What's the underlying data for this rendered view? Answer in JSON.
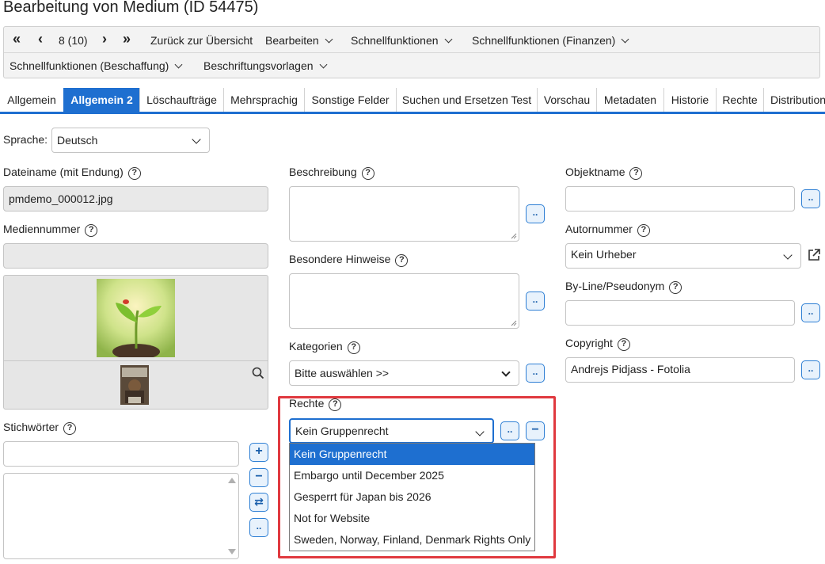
{
  "page_title": "Bearbeitung von Medium (ID 54475)",
  "toolbar": {
    "first_icon": "«",
    "prev_icon": "‹",
    "page_counter": "8 (10)",
    "next_icon": "›",
    "last_icon": "»",
    "back_label": "Zurück zur Übersicht",
    "menus": [
      "Bearbeiten",
      "Schnellfunktionen",
      "Schnellfunktionen (Finanzen)",
      "Schnellfunktionen (Beschaffung)",
      "Beschriftungsvorlagen"
    ]
  },
  "tabs": [
    "Allgemein",
    "Allgemein 2",
    "Löschaufträge",
    "Mehrsprachig",
    "Sonstige Felder",
    "Suchen und Ersetzen Test",
    "Vorschau",
    "Metadaten",
    "Historie",
    "Rechte",
    "Distribution"
  ],
  "active_tab": "Allgemein 2",
  "language": {
    "label": "Sprache:",
    "value": "Deutsch"
  },
  "left": {
    "filename_label": "Dateiname (mit Endung)",
    "filename_value": "pmdemo_000012.jpg",
    "media_number_label": "Mediennummer",
    "media_number_value": "",
    "keywords_label": "Stichwörter"
  },
  "middle": {
    "description_label": "Beschreibung",
    "special_notes_label": "Besondere Hinweise",
    "categories_label": "Kategorien",
    "categories_value": "Bitte auswählen >>",
    "rights_label": "Rechte",
    "rights_value": "Kein Gruppenrecht",
    "rights_options": [
      "Kein Gruppenrecht",
      "Embargo until December 2025",
      "Gesperrt für Japan bis 2026",
      "Not for Website",
      "Sweden, Norway, Finland, Denmark Rights Only"
    ]
  },
  "right": {
    "object_name_label": "Objektname",
    "object_name_value": "",
    "author_number_label": "Autornummer",
    "author_number_value": "Kein Urheber",
    "byline_label": "By-Line/Pseudonym",
    "byline_value": "",
    "copyright_label": "Copyright",
    "copyright_value": "Andrejs Pidjass - Fotolia"
  },
  "small_button_label": "..",
  "icons": {
    "help": "?",
    "plus": "+",
    "minus": "−",
    "swap": "⇄",
    "search": "search-icon",
    "external": "external-link-icon"
  },
  "colors": {
    "accent": "#1e6fd0",
    "highlight": "#e0393f",
    "button_bg": "#e8f2fc"
  }
}
